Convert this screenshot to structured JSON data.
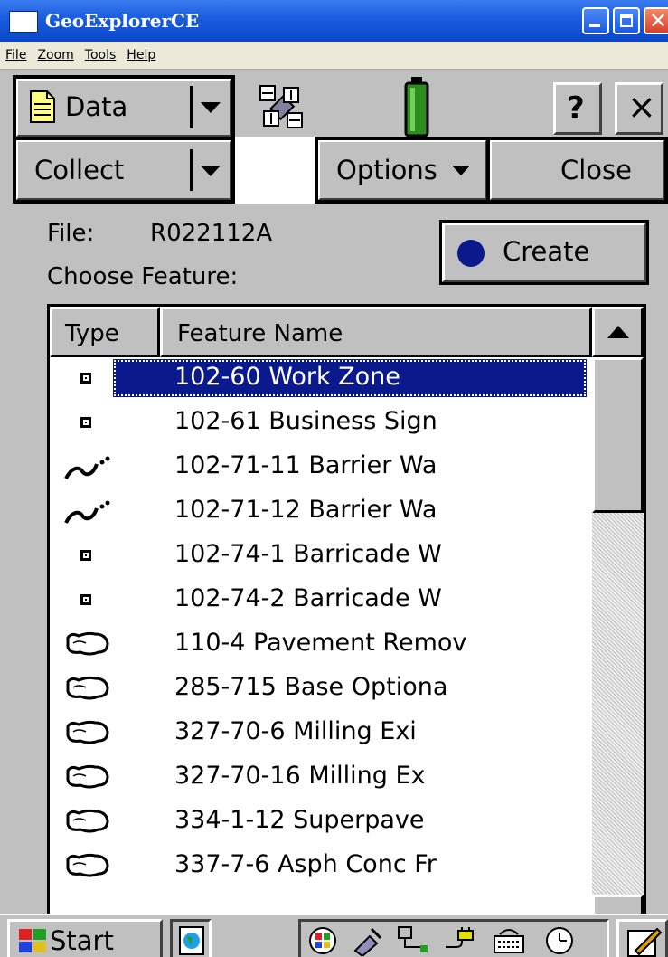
{
  "window": {
    "title": "GeoExplorerCE"
  },
  "menu": [
    "File",
    "Zoom",
    "Tools",
    "Help"
  ],
  "toolbar": {
    "data_label": "Data",
    "help_label": "?",
    "close_x": "×",
    "collect_label": "Collect",
    "options_label": "Options",
    "close_label": "Close"
  },
  "form": {
    "file_label": "File:",
    "file_value": "R022112A",
    "choose_label": "Choose Feature:",
    "create_label": "Create"
  },
  "list": {
    "columns": [
      "Type",
      "Feature Name"
    ],
    "rows": [
      {
        "type": "point",
        "name": "102-60 Work Zone",
        "selected": true
      },
      {
        "type": "point",
        "name": "102-61 Business Sign",
        "selected": false
      },
      {
        "type": "line",
        "name": "102-71-11 Barrier Wa",
        "selected": false
      },
      {
        "type": "line",
        "name": "102-71-12 Barrier Wa",
        "selected": false
      },
      {
        "type": "point",
        "name": "102-74-1 Barricade W",
        "selected": false
      },
      {
        "type": "point",
        "name": "102-74-2 Barricade W",
        "selected": false
      },
      {
        "type": "area",
        "name": "110-4 Pavement Remov",
        "selected": false
      },
      {
        "type": "area",
        "name": "285-715 Base Optiona",
        "selected": false
      },
      {
        "type": "area",
        "name": "327-70-6 Milling Exi",
        "selected": false
      },
      {
        "type": "area",
        "name": "327-70-16 Milling Ex",
        "selected": false
      },
      {
        "type": "area",
        "name": "334-1-12 Superpave",
        "selected": false
      },
      {
        "type": "area",
        "name": "337-7-6 Asph Conc Fr",
        "selected": false
      }
    ]
  },
  "taskbar": {
    "start_label": "Start"
  },
  "colors": {
    "selection": "#0a1a8c",
    "titlebar": "#1c5fe0",
    "create_dot": "#0a1a8c"
  }
}
